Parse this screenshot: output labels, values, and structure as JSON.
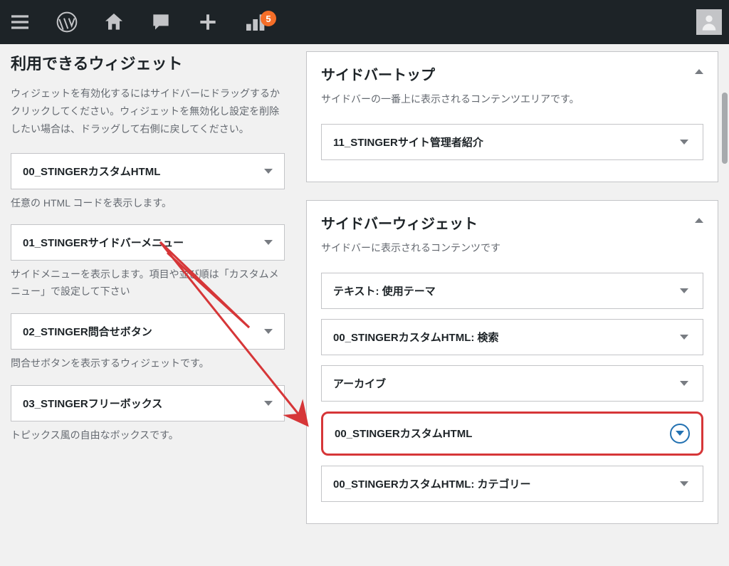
{
  "adminBar": {
    "notificationCount": "5"
  },
  "leftPanel": {
    "title": "利用できるウィジェット",
    "description": "ウィジェットを有効化するにはサイドバーにドラッグするかクリックしてください。ウィジェットを無効化し設定を削除したい場合は、ドラッグして右側に戻してください。",
    "widgets": [
      {
        "title": "00_STINGERカスタムHTML",
        "desc": "任意の HTML コードを表示します。"
      },
      {
        "title": "01_STINGERサイドバーメニュー",
        "desc": "サイドメニューを表示します。項目や並び順は「カスタムメニュー」で設定して下さい"
      },
      {
        "title": "02_STINGER問合せボタン",
        "desc": "問合せボタンを表示するウィジェットです。"
      },
      {
        "title": "03_STINGERフリーボックス",
        "desc": "トピックス風の自由なボックスです。"
      }
    ]
  },
  "rightPanel": {
    "areas": [
      {
        "title": "サイドバートップ",
        "desc": "サイドバーの一番上に表示されるコンテンツエリアです。",
        "widgets": [
          {
            "title": "11_STINGERサイト管理者紹介"
          }
        ]
      },
      {
        "title": "サイドバーウィジェット",
        "desc": "サイドバーに表示されるコンテンツです",
        "widgets": [
          {
            "title": "テキスト: 使用テーマ"
          },
          {
            "title": "00_STINGERカスタムHTML: 検索"
          },
          {
            "title": "アーカイブ"
          },
          {
            "title": "00_STINGERカスタムHTML",
            "highlighted": true
          },
          {
            "title": "00_STINGERカスタムHTML: カテゴリー"
          }
        ]
      }
    ]
  }
}
